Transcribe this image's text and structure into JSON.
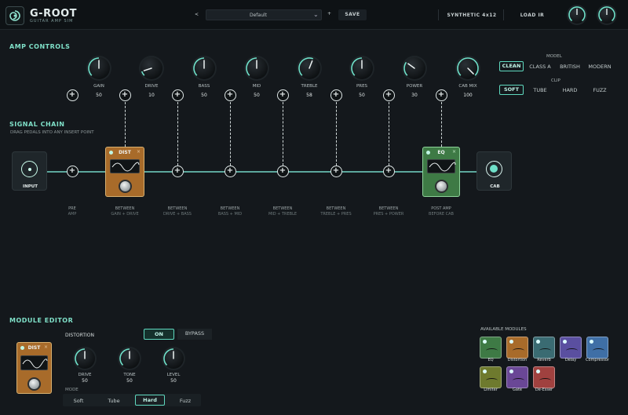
{
  "header": {
    "brand": "G-ROOT",
    "brand_sub": "GUITAR AMP SIM",
    "prev": "<",
    "preset": "Default",
    "next": "+",
    "save": "SAVE",
    "cabinet": "SYNTHETIC 4x12",
    "load_ir": "LOAD IR"
  },
  "amp": {
    "title": "AMP CONTROLS",
    "knobs": [
      {
        "label": "GAIN",
        "value": "50",
        "level": 0.5
      },
      {
        "label": "DRIVE",
        "value": "10",
        "level": 0.1
      },
      {
        "label": "BASS",
        "value": "50",
        "level": 0.5
      },
      {
        "label": "MID",
        "value": "50",
        "level": 0.5
      },
      {
        "label": "TREBLE",
        "value": "58",
        "level": 0.58
      },
      {
        "label": "PRES",
        "value": "50",
        "level": 0.5
      },
      {
        "label": "POWER",
        "value": "30",
        "level": 0.3
      },
      {
        "label": "CAB MIX",
        "value": "100",
        "level": 1.0
      }
    ],
    "model_label": "MODEL",
    "models": [
      "CLEAN",
      "CLASS A",
      "BRITISH",
      "MODERN"
    ],
    "clip_label": "CLIP",
    "clips": [
      "SOFT",
      "TUBE",
      "HARD",
      "FUZZ"
    ]
  },
  "chain": {
    "title": "SIGNAL CHAIN",
    "subtitle": "DRAG PEDALS INTO ANY INSERT POINT",
    "input": "INPUT",
    "cab": "CAB",
    "dist": "DIST",
    "eq": "EQ",
    "x": "×",
    "points": [
      {
        "a": "PRE",
        "b": "AMP"
      },
      {
        "a": "BETWEEN",
        "b": "GAIN + DRIVE"
      },
      {
        "a": "BETWEEN",
        "b": "DRIVE + BASS"
      },
      {
        "a": "BETWEEN",
        "b": "BASS + MID"
      },
      {
        "a": "BETWEEN",
        "b": "MID + TREBLE"
      },
      {
        "a": "BETWEEN",
        "b": "TREBLE + PRES"
      },
      {
        "a": "BETWEEN",
        "b": "PRES + POWER"
      },
      {
        "a": "POST AMP",
        "b": "BEFORE CAB"
      }
    ]
  },
  "editor": {
    "title": "MODULE EDITOR",
    "module": "DISTORTION",
    "pedal": "DIST",
    "on": "ON",
    "bypass": "BYPASS",
    "knobs": [
      {
        "label": "DRIVE",
        "value": "50",
        "level": 0.5
      },
      {
        "label": "TONE",
        "value": "50",
        "level": 0.5
      },
      {
        "label": "LEVEL",
        "value": "50",
        "level": 0.5
      }
    ],
    "mode_label": "MODE",
    "modes": [
      "Soft",
      "Tube",
      "Hard",
      "Fuzz"
    ]
  },
  "modules": {
    "title": "AVAILABLE MODULES",
    "items": [
      {
        "name": "EQ",
        "color": "#3e7a45"
      },
      {
        "name": "Distortion",
        "color": "#a86b2a"
      },
      {
        "name": "Reverb",
        "color": "#3a6b72"
      },
      {
        "name": "Delay",
        "color": "#5a4fa0"
      },
      {
        "name": "Compressor",
        "color": "#3f6fa6"
      },
      {
        "name": "Limiter",
        "color": "#6e7a2e"
      },
      {
        "name": "Gate",
        "color": "#6a4796"
      },
      {
        "name": "De-Esser",
        "color": "#a0413f"
      }
    ]
  }
}
